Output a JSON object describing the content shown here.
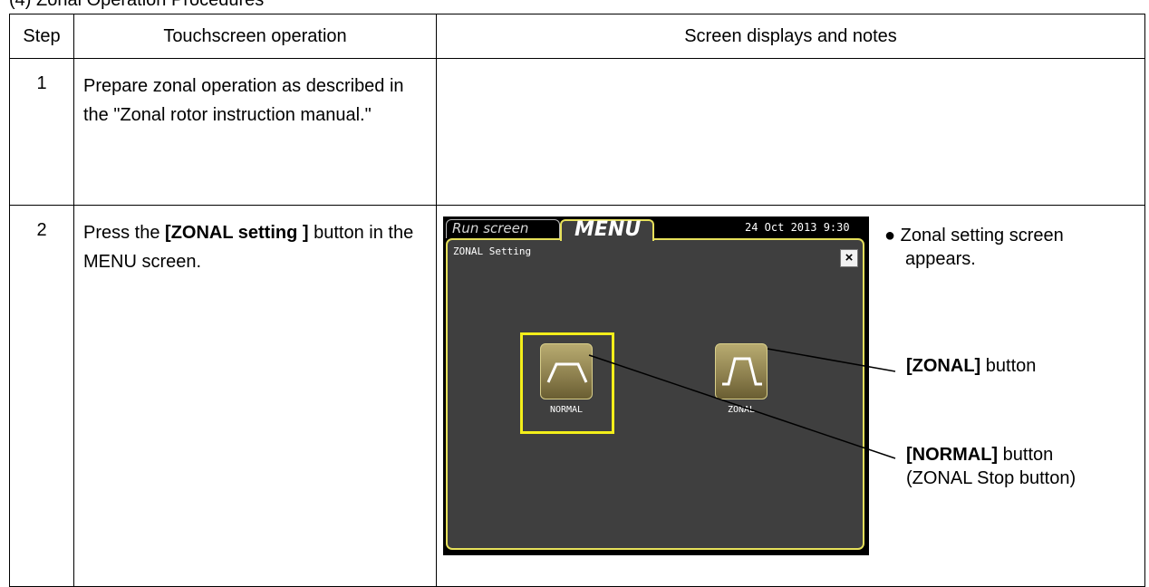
{
  "section": {
    "title": "(4) Zonal Operation Procedures"
  },
  "table": {
    "headers": {
      "step": "Step",
      "operation": "Touchscreen operation",
      "notes": "Screen displays and notes"
    },
    "rows": [
      {
        "step": "1",
        "operation": "Prepare zonal operation as described in the \"Zonal rotor instruction manual.\""
      },
      {
        "step": "2",
        "operation_prefix": "Press the ",
        "operation_bold": "[ZONAL setting ]",
        "operation_suffix": " button in the MENU screen."
      }
    ]
  },
  "screen": {
    "tab_run": "Run screen",
    "tab_menu": "MENU",
    "datetime": "24 Oct 2013  9:30",
    "title": "ZONAL Setting",
    "close_symbol": "×",
    "normal_label": "NORMAL",
    "zonal_label": "ZONAL",
    "colors": {
      "frame": "#e6e05a",
      "highlight": "#f3ee1a",
      "background": "#3f3f3f"
    }
  },
  "notes": {
    "bullet_symbol": "●",
    "bullet_line1": "Zonal setting screen",
    "bullet_line2": "appears.",
    "zonal_bold": "[ZONAL]",
    "zonal_suffix": " button",
    "normal_bold": "[NORMAL]",
    "normal_suffix": " button",
    "normal_line2": "(ZONAL Stop button)"
  }
}
